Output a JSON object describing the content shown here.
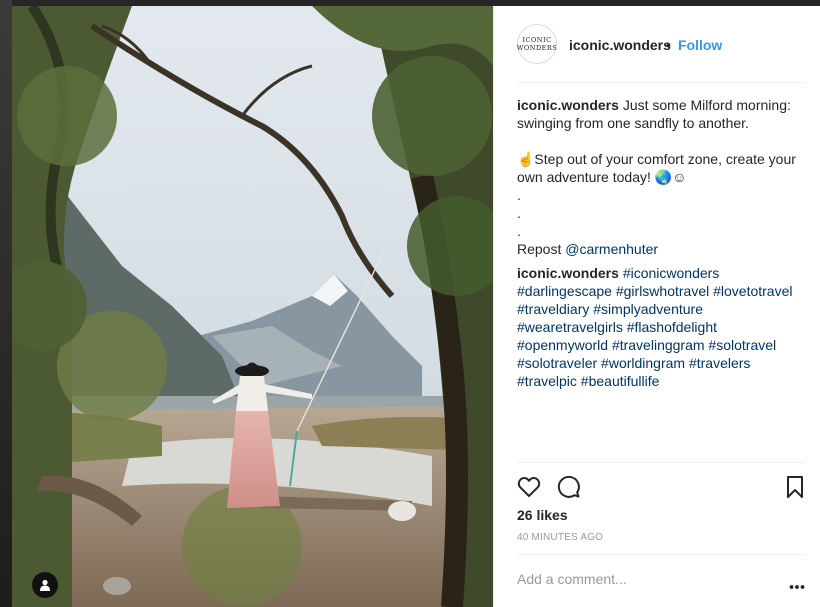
{
  "post": {
    "username": "iconic.wonders",
    "separator": "•",
    "follow_label": "Follow",
    "avatar_text_line1": "ICONIC",
    "avatar_text_line2": "WONDERS",
    "caption": {
      "username": "iconic.wonders",
      "line1": "Just some Milford morning: swinging from one sandfly to another.",
      "line2": "☝Step out of your comfort zone, create your own adventure today! 🌏☺",
      "dot1": ".",
      "dot2": ".",
      "dot3": ".",
      "repost_prefix": "Repost ",
      "repost_handle": "@carmenhuter"
    },
    "comment": {
      "username": "iconic.wonders",
      "hashtags": "#iconicwonders #darlingescape #girlswhotravel #lovetotravel #traveldiary #simplyadventure #wearetravelgirls #flashofdelight #openmyworld #travelinggram #solotravel #solotraveler #worldingram #travelers #travelpic #beautifullife"
    },
    "likes": "26 likes",
    "time": "40 MINUTES AGO",
    "comment_placeholder": "Add a comment..."
  },
  "icons": {
    "like": "heart-icon",
    "comment": "comment-icon",
    "save": "bookmark-icon",
    "more": "more-options-icon",
    "tag": "user-tag-icon"
  },
  "colors": {
    "link": "#003569",
    "follow": "#3897f0",
    "text": "#262626",
    "muted": "#999999"
  }
}
